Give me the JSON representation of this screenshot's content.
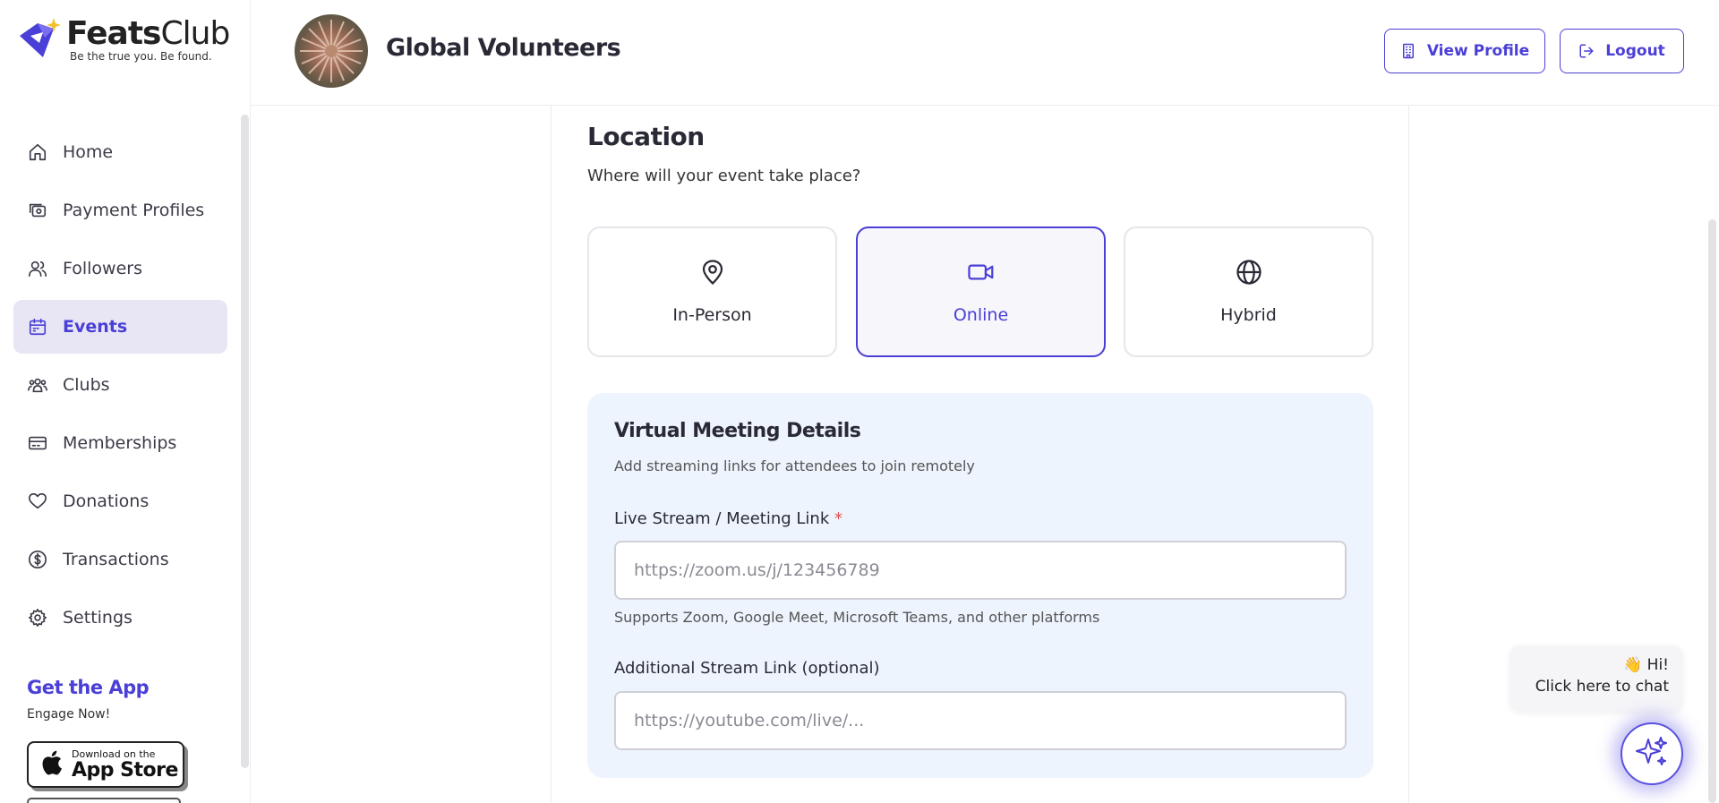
{
  "brand": {
    "name_bold": "Feats",
    "name_light": "Club",
    "tagline": "Be the true you. Be found."
  },
  "sidebar": {
    "items": [
      {
        "label": "Home",
        "icon": "home-icon",
        "active": false
      },
      {
        "label": "Payment Profiles",
        "icon": "payment-icon",
        "active": false
      },
      {
        "label": "Followers",
        "icon": "users-icon",
        "active": false
      },
      {
        "label": "Events",
        "icon": "calendar-icon",
        "active": true
      },
      {
        "label": "Clubs",
        "icon": "group-icon",
        "active": false
      },
      {
        "label": "Memberships",
        "icon": "card-icon",
        "active": false
      },
      {
        "label": "Donations",
        "icon": "heart-icon",
        "active": false
      },
      {
        "label": "Transactions",
        "icon": "dollar-icon",
        "active": false
      },
      {
        "label": "Settings",
        "icon": "gear-icon",
        "active": false
      }
    ],
    "get_app": {
      "title": "Get the App",
      "subtitle": "Engage Now!",
      "appstore_small": "Download on the",
      "appstore_big": "App Store"
    }
  },
  "header": {
    "org_name": "Global Volunteers",
    "view_profile": "View Profile",
    "logout": "Logout"
  },
  "location": {
    "title": "Location",
    "subtitle": "Where will your event take place?",
    "options": [
      {
        "label": "In-Person",
        "icon": "map-pin-icon",
        "selected": false
      },
      {
        "label": "Online",
        "icon": "video-icon",
        "selected": true
      },
      {
        "label": "Hybrid",
        "icon": "globe-icon",
        "selected": false
      }
    ]
  },
  "virtual": {
    "title": "Virtual Meeting Details",
    "subtitle": "Add streaming links for attendees to join remotely",
    "link_label": "Live Stream / Meeting Link",
    "required_mark": "*",
    "link_placeholder": "https://zoom.us/j/123456789",
    "link_help": "Supports Zoom, Google Meet, Microsoft Teams, and other platforms",
    "additional_label": "Additional Stream Link (optional)",
    "additional_placeholder": "https://youtube.com/live/..."
  },
  "chat": {
    "greeting": "👋 Hi!",
    "cta": "Click here to chat"
  },
  "colors": {
    "accent": "#4a3fd6",
    "active_bg": "#e8e6f4",
    "virtual_bg": "#eef4fd",
    "required": "#e14d4d"
  }
}
